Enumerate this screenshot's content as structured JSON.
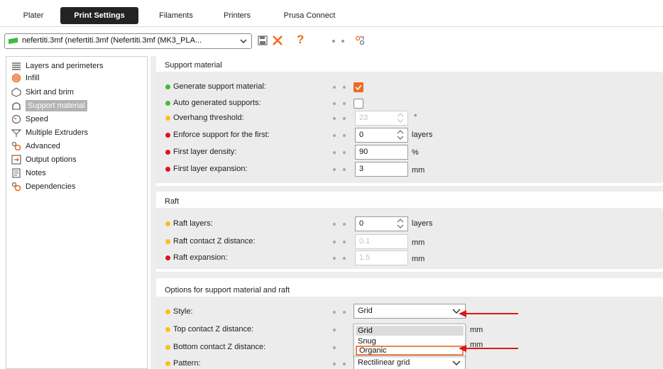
{
  "tabs": [
    {
      "label": "Plater",
      "active": false
    },
    {
      "label": "Print Settings",
      "active": true
    },
    {
      "label": "Filaments",
      "active": false
    },
    {
      "label": "Printers",
      "active": false
    },
    {
      "label": "Prusa Connect",
      "active": false
    }
  ],
  "toolbar": {
    "preset_text": "nefertiti.3mf (nefertiti.3mf (Nefertiti.3mf (MK3_PLA...",
    "question_label": "?"
  },
  "sidebar": {
    "items": [
      {
        "label": "Layers and perimeters",
        "icon": "layers-icon"
      },
      {
        "label": "Infill",
        "icon": "infill-icon"
      },
      {
        "label": "Skirt and brim",
        "icon": "skirt-icon"
      },
      {
        "label": "Support material",
        "icon": "support-icon",
        "selected": true
      },
      {
        "label": "Speed",
        "icon": "speed-icon"
      },
      {
        "label": "Multiple Extruders",
        "icon": "extruders-icon"
      },
      {
        "label": "Advanced",
        "icon": "advanced-icon"
      },
      {
        "label": "Output options",
        "icon": "output-icon"
      },
      {
        "label": "Notes",
        "icon": "notes-icon"
      },
      {
        "label": "Dependencies",
        "icon": "dependencies-icon"
      }
    ]
  },
  "colors": {
    "simple": "#3dbb3d",
    "advanced": "#f6c21c",
    "expert": "#e0121a",
    "accent": "#ed6b21"
  },
  "support": {
    "title": "Support material",
    "rows": {
      "generate": {
        "label": "Generate support material:",
        "checked": true
      },
      "auto": {
        "label": "Auto generated supports:",
        "checked": false
      },
      "overhang": {
        "label": "Overhang threshold:",
        "value": "23",
        "unit": "°"
      },
      "enforce": {
        "label": "Enforce support for the first:",
        "value": "0",
        "unit": "layers"
      },
      "density": {
        "label": "First layer density:",
        "value": "90",
        "unit": "%"
      },
      "expansion": {
        "label": "First layer expansion:",
        "value": "3",
        "unit": "mm"
      }
    }
  },
  "raft": {
    "title": "Raft",
    "rows": {
      "layers": {
        "label": "Raft layers:",
        "value": "0",
        "unit": "layers"
      },
      "contact": {
        "label": "Raft contact Z distance:",
        "value": "0.1",
        "unit": "mm"
      },
      "expansion": {
        "label": "Raft expansion:",
        "value": "1.5",
        "unit": "mm"
      }
    }
  },
  "options": {
    "title": "Options for support material and raft",
    "rows": {
      "style": {
        "label": "Style:",
        "value": "Grid"
      },
      "top": {
        "label": "Top contact Z distance:",
        "unit": "mm"
      },
      "bottom": {
        "label": "Bottom contact Z distance:",
        "unit": "mm"
      },
      "pattern": {
        "label": "Pattern:",
        "value": "Rectilinear grid"
      }
    },
    "dropdown": [
      "Grid",
      "Snug",
      "Organic"
    ]
  }
}
